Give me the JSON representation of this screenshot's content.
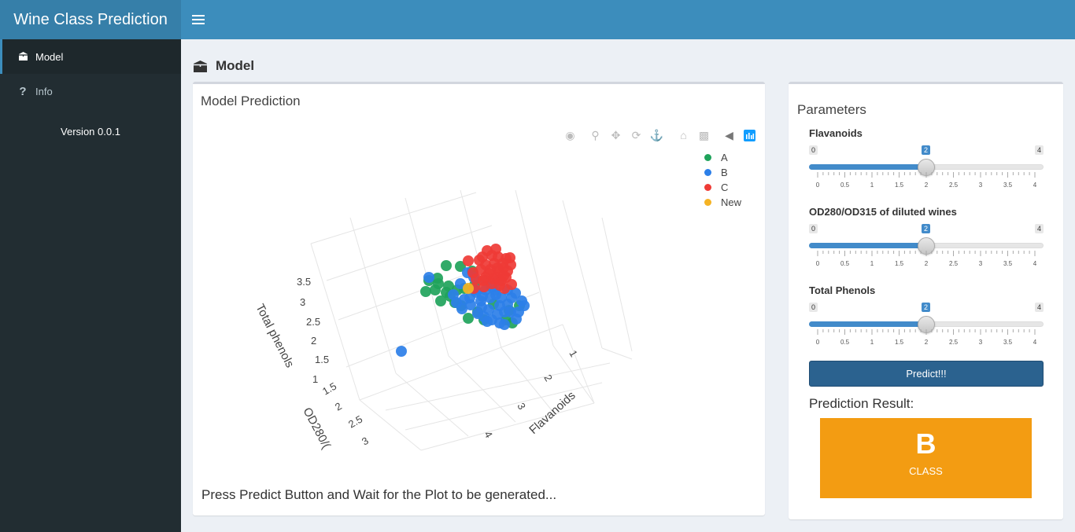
{
  "app": {
    "title": "Wine Class Prediction"
  },
  "sidebar": {
    "items": [
      {
        "label": "Model",
        "icon": "cube-icon",
        "active": true
      },
      {
        "label": "Info",
        "icon": "question-icon",
        "active": false
      }
    ],
    "version": "Version 0.0.1"
  },
  "page": {
    "title": "Model"
  },
  "model_box": {
    "title": "Model Prediction",
    "status": "Press Predict Button and Wait for the Plot to be generated..."
  },
  "plot": {
    "legend": [
      {
        "name": "A",
        "color": "#1fa35b"
      },
      {
        "name": "B",
        "color": "#2c7fe8"
      },
      {
        "name": "C",
        "color": "#ef3b36"
      },
      {
        "name": "New",
        "color": "#f5b324"
      }
    ],
    "axes": {
      "z_label": "Total phenols",
      "y_label": "OD280/(",
      "x_label": "Flavanoids",
      "z_ticks": [
        "1",
        "1.5",
        "2",
        "2.5",
        "3",
        "3.5"
      ],
      "y_ticks": [
        "1.5",
        "2",
        "2.5",
        "3"
      ],
      "x_ticks": [
        "1",
        "2",
        "3",
        "4"
      ]
    },
    "toolbar": [
      "camera-icon",
      "zoom-icon",
      "pan-icon",
      "orbit-icon",
      "turntable-icon",
      "home-icon",
      "video-icon",
      "spike-icon",
      "plotly-logo-icon"
    ]
  },
  "parameters": {
    "title": "Parameters",
    "sliders": [
      {
        "label": "Flavanoids",
        "min": "0",
        "max": "4",
        "value": "2",
        "ticks": [
          "0",
          "0.5",
          "1",
          "1.5",
          "2",
          "2.5",
          "3",
          "3.5",
          "4"
        ],
        "fraction": 0.5
      },
      {
        "label": "OD280/OD315 of diluted wines",
        "min": "0",
        "max": "4",
        "value": "2",
        "ticks": [
          "0",
          "0.5",
          "1",
          "1.5",
          "2",
          "2.5",
          "3",
          "3.5",
          "4"
        ],
        "fraction": 0.5
      },
      {
        "label": "Total Phenols",
        "min": "0",
        "max": "4",
        "value": "2",
        "ticks": [
          "0",
          "0.5",
          "1",
          "1.5",
          "2",
          "2.5",
          "3",
          "3.5",
          "4"
        ],
        "fraction": 0.5
      }
    ],
    "predict_label": "Predict!!!",
    "result_label": "Prediction Result:",
    "result_value": "B",
    "result_sub": "CLASS",
    "result_color": "#f39c12"
  }
}
